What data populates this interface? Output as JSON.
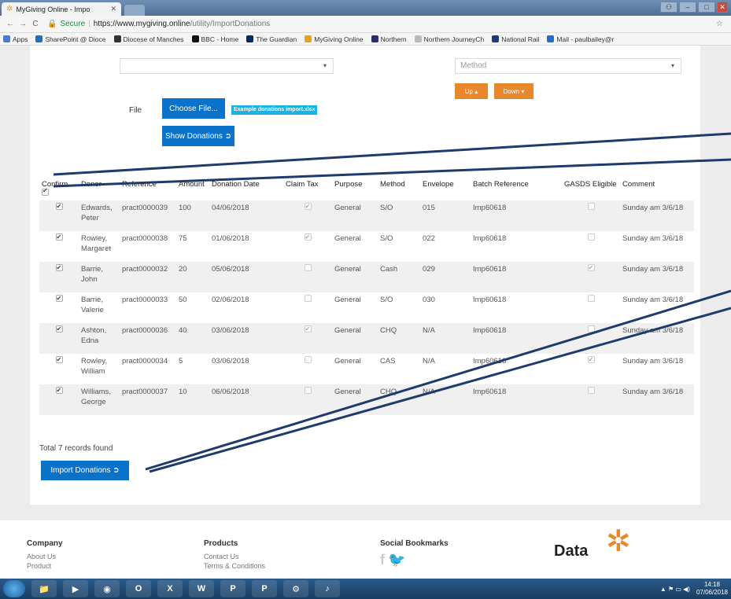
{
  "browser": {
    "tab_title": "MyGiving Online - Impo",
    "secure_label": "Secure",
    "url_host": "https://www.mygiving.online",
    "url_path": "/utility/ImportDonations",
    "bookmarks": [
      {
        "label": "Apps",
        "color": "#4a7bd0"
      },
      {
        "label": "SharePoint @ Dioce",
        "color": "#1e6fc5"
      },
      {
        "label": "Diocese of Manches",
        "color": "#333333"
      },
      {
        "label": "BBC - Home",
        "color": "#111111"
      },
      {
        "label": "The Guardian",
        "color": "#052962"
      },
      {
        "label": "MyGiving Online",
        "color": "#e8a21a"
      },
      {
        "label": "Northern",
        "color": "#2d2d6b"
      },
      {
        "label": "Northern JourneyCh",
        "color": "#bbbbbb"
      },
      {
        "label": "National Rail",
        "color": "#1a3d7a"
      },
      {
        "label": "Mail - paulbailey@r",
        "color": "#1e6fc5"
      }
    ]
  },
  "form": {
    "method_placeholder": "Method",
    "up_label": "Up ▴",
    "down_label": "Down ▾",
    "file_label": "File",
    "choose_file_label": "Choose File...",
    "example_link": "Example donations import.xlsx",
    "show_donations_label": "Show Donations ➲"
  },
  "table": {
    "headers": [
      "Confirm",
      "Donor",
      "Reference",
      "Amount",
      "Donation Date",
      "Claim Tax",
      "Purpose",
      "Method",
      "Envelope",
      "Batch Reference",
      "GASDS Eligible",
      "Comment"
    ],
    "rows": [
      {
        "donor": "Edwards, Peter",
        "reference": "pract0000039",
        "amount": "100",
        "date": "04/06/2018",
        "claim_tax": true,
        "purpose": "General",
        "method": "S/O",
        "envelope": "015",
        "batch": "Imp60618",
        "gasds": false,
        "comment": "Sunday am 3/6/18"
      },
      {
        "donor": "Rowley, Margaret",
        "reference": "pract0000038",
        "amount": "75",
        "date": "01/06/2018",
        "claim_tax": true,
        "purpose": "General",
        "method": "S/O",
        "envelope": "022",
        "batch": "Imp60618",
        "gasds": false,
        "comment": "Sunday am 3/6/18"
      },
      {
        "donor": "Barrie, John",
        "reference": "pract0000032",
        "amount": "20",
        "date": "05/06/2018",
        "claim_tax": false,
        "purpose": "General",
        "method": "Cash",
        "envelope": "029",
        "batch": "Imp60618",
        "gasds": true,
        "comment": "Sunday am 3/6/18"
      },
      {
        "donor": "Barrie, Valerie",
        "reference": "pract0000033",
        "amount": "50",
        "date": "02/06/2018",
        "claim_tax": false,
        "purpose": "General",
        "method": "S/O",
        "envelope": "030",
        "batch": "Imp60618",
        "gasds": false,
        "comment": "Sunday am 3/6/18"
      },
      {
        "donor": "Ashton, Edna",
        "reference": "pract0000036",
        "amount": "40",
        "date": "03/06/2018",
        "claim_tax": true,
        "purpose": "General",
        "method": "CHQ",
        "envelope": "N/A",
        "batch": "Imp60618",
        "gasds": false,
        "comment": "Sunday am 3/6/18"
      },
      {
        "donor": "Rowley, William",
        "reference": "pract0000034",
        "amount": "5",
        "date": "03/06/2018",
        "claim_tax": false,
        "purpose": "General",
        "method": "CAS",
        "envelope": "N/A",
        "batch": "Imp60618",
        "gasds": true,
        "comment": "Sunday am 3/6/18"
      },
      {
        "donor": "Williams, George",
        "reference": "pract0000037",
        "amount": "10",
        "date": "06/06/2018",
        "claim_tax": false,
        "purpose": "General",
        "method": "CHQ",
        "envelope": "N/A",
        "batch": "Imp60618",
        "gasds": false,
        "comment": "Sunday am 3/6/18"
      }
    ]
  },
  "total_text": "Total 7 records found",
  "import_label": "Import Donations ➲",
  "footer": {
    "company_heading": "Company",
    "company_links": [
      "About Us",
      "Product"
    ],
    "products_heading": "Products",
    "products_links": [
      "Contact Us",
      "Terms & Conditions"
    ],
    "social_heading": "Social Bookmarks",
    "logo_text": "Data"
  },
  "taskbar": {
    "apps": [
      "📁",
      "▶",
      "◉",
      "O",
      "X",
      "W",
      "P",
      "P",
      "⚙",
      "♪"
    ],
    "time": "14:18",
    "date": "07/06/2018"
  }
}
